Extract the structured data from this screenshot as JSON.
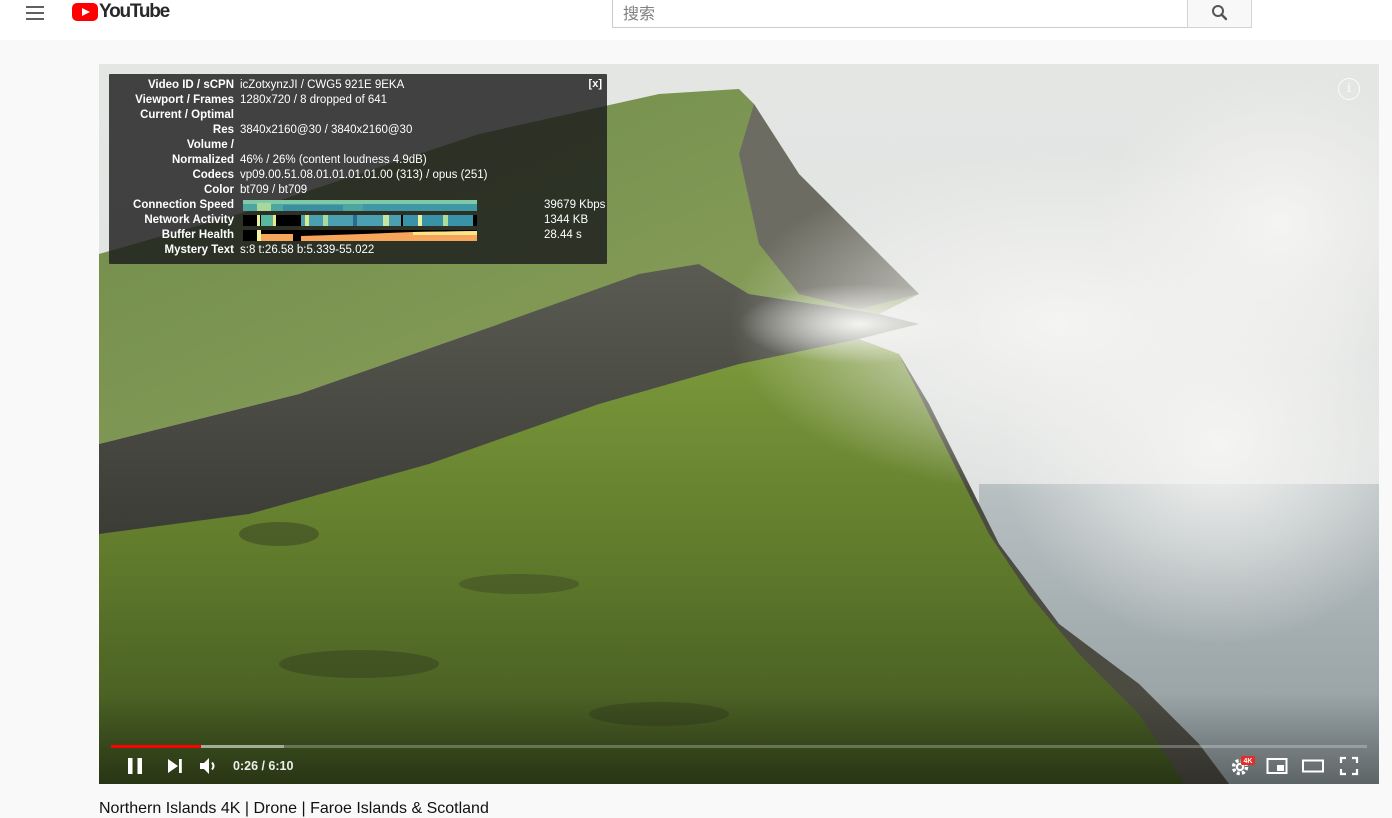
{
  "masthead": {
    "logo_text": "YouTube",
    "search_placeholder": "搜索"
  },
  "stats": {
    "close_label": "[x]",
    "rows": [
      {
        "label": "Video ID / sCPN",
        "value": "icZotxynzJI / CWG5 921E 9EKA"
      },
      {
        "label": "Viewport / Frames",
        "value": "1280x720 / 8 dropped of 641"
      },
      {
        "label": "Current / Optimal",
        "value": ""
      },
      {
        "label": "Res",
        "value": "3840x2160@30 / 3840x2160@30"
      },
      {
        "label": "Volume /",
        "value": ""
      },
      {
        "label": "Normalized",
        "value": "46% / 26% (content loudness 4.9dB)"
      },
      {
        "label": "Codecs",
        "value": "vp09.00.51.08.01.01.01.01.00 (313) / opus (251)"
      },
      {
        "label": "Color",
        "value": "bt709 / bt709"
      }
    ],
    "graphs": [
      {
        "label": "Connection Speed",
        "value": "39679 Kbps"
      },
      {
        "label": "Network Activity",
        "value": "1344 KB"
      },
      {
        "label": "Buffer Health",
        "value": "28.44 s"
      }
    ],
    "mystery": {
      "label": "Mystery Text",
      "value": "s:8 t:26.58 b:5.339-55.022"
    }
  },
  "player": {
    "info_glyph": "i",
    "time_display": "0:26 / 6:10",
    "played_fraction": 0.072,
    "loaded_fraction": 0.138,
    "quality_badge": "4K",
    "accent_color": "#ff0000"
  },
  "below": {
    "title_partial": "Northern Islands 4K | Drone | Faroe Islands & Scotland"
  }
}
